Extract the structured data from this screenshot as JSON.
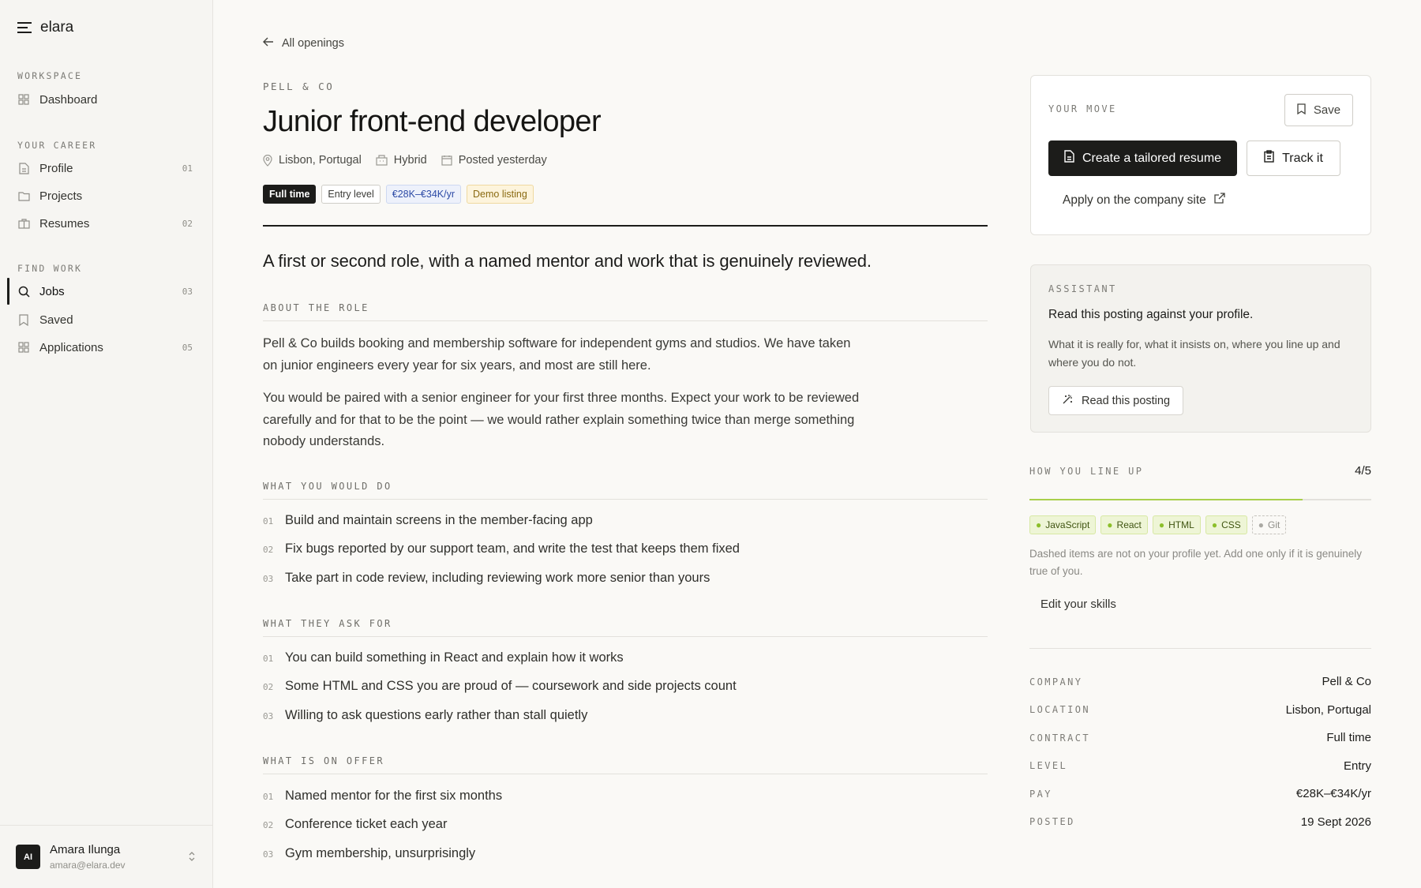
{
  "app": {
    "name": "elara"
  },
  "sidebar": {
    "groups": [
      {
        "label": "WORKSPACE"
      },
      {
        "label": "YOUR CAREER"
      },
      {
        "label": "FIND WORK"
      }
    ],
    "items": [
      {
        "label": "Dashboard",
        "count": ""
      },
      {
        "label": "Profile",
        "count": "01"
      },
      {
        "label": "Projects",
        "count": ""
      },
      {
        "label": "Resumes",
        "count": "02"
      },
      {
        "label": "Jobs",
        "count": "03"
      },
      {
        "label": "Saved",
        "count": ""
      },
      {
        "label": "Applications",
        "count": "05"
      }
    ],
    "user": {
      "initials": "AI",
      "name": "Amara Ilunga",
      "email": "amara@elara.dev"
    }
  },
  "main": {
    "back_label": "All openings",
    "company": "PELL & CO",
    "title": "Junior front-end developer",
    "meta": {
      "location": "Lisbon, Portugal",
      "mode": "Hybrid",
      "posted": "Posted yesterday"
    },
    "tags": [
      "Full time",
      "Entry level",
      "€28K–€34K/yr",
      "Demo listing"
    ],
    "lead": "A first or second role, with a named mentor and work that is genuinely reviewed.",
    "about": {
      "label": "ABOUT THE ROLE",
      "paragraphs": [
        "Pell & Co builds booking and membership software for independent gyms and studios. We have taken on junior engineers every year for six years, and most are still here.",
        "You would be paired with a senior engineer for your first three months. Expect your work to be reviewed carefully and for that to be the point — we would rather explain something twice than merge something nobody understands."
      ]
    },
    "do": {
      "label": "WHAT YOU WOULD DO",
      "items": [
        {
          "num": "01",
          "text": "Build and maintain screens in the member-facing app"
        },
        {
          "num": "02",
          "text": "Fix bugs reported by our support team, and write the test that keeps them fixed"
        },
        {
          "num": "03",
          "text": "Take part in code review, including reviewing work more senior than yours"
        }
      ]
    },
    "ask": {
      "label": "WHAT THEY ASK FOR",
      "items": [
        {
          "num": "01",
          "text": "You can build something in React and explain how it works"
        },
        {
          "num": "02",
          "text": "Some HTML and CSS you are proud of — coursework and side projects count"
        },
        {
          "num": "03",
          "text": "Willing to ask questions early rather than stall quietly"
        }
      ]
    },
    "offer": {
      "label": "WHAT IS ON OFFER",
      "items": [
        {
          "num": "01",
          "text": "Named mentor for the first six months"
        },
        {
          "num": "02",
          "text": "Conference ticket each year"
        },
        {
          "num": "03",
          "text": "Gym membership, unsurprisingly"
        }
      ]
    }
  },
  "move": {
    "label": "YOUR MOVE",
    "save_label": "Save",
    "create_label": "Create a tailored resume",
    "track_label": "Track it",
    "apply_label": "Apply on the company site"
  },
  "assistant": {
    "label": "ASSISTANT",
    "heading": "Read this posting against your profile.",
    "body": "What it is really for, what it insists on, where you line up and where you do not.",
    "button_label": "Read this posting"
  },
  "lineup": {
    "label": "HOW YOU LINE UP",
    "score": "4/5",
    "progress_fraction": 0.8,
    "skills": [
      {
        "name": "JavaScript",
        "have": true
      },
      {
        "name": "React",
        "have": true
      },
      {
        "name": "HTML",
        "have": true
      },
      {
        "name": "CSS",
        "have": true
      },
      {
        "name": "Git",
        "have": false
      }
    ],
    "note": "Dashed items are not on your profile yet. Add one only if it is genuinely true of you.",
    "edit_label": "Edit your skills"
  },
  "facts": [
    {
      "key": "COMPANY",
      "value": "Pell & Co"
    },
    {
      "key": "LOCATION",
      "value": "Lisbon, Portugal"
    },
    {
      "key": "CONTRACT",
      "value": "Full time"
    },
    {
      "key": "LEVEL",
      "value": "Entry"
    },
    {
      "key": "PAY",
      "value": "€28K–€34K/yr"
    },
    {
      "key": "POSTED",
      "value": "19 Sept 2026"
    }
  ]
}
